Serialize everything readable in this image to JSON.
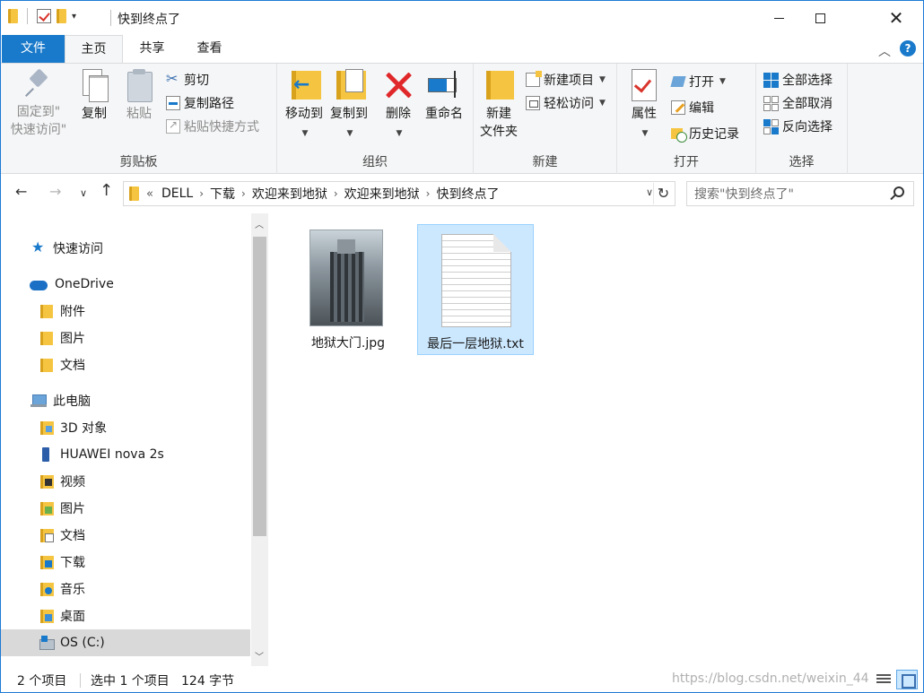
{
  "window": {
    "title": "快到终点了"
  },
  "ribbon_tabs": [
    "文件",
    "主页",
    "共享",
    "查看"
  ],
  "clipboard": {
    "pin_label_1": "固定到\"",
    "pin_label_2": "快速访问\"",
    "copy": "复制",
    "paste": "粘贴",
    "cut": "剪切",
    "copy_path": "复制路径",
    "paste_shortcut": "粘贴快捷方式",
    "group": "剪贴板"
  },
  "organize": {
    "move_to": "移动到",
    "copy_to": "复制到",
    "delete": "删除",
    "rename": "重命名",
    "group": "组织"
  },
  "new": {
    "new_folder_1": "新建",
    "new_folder_2": "文件夹",
    "new_item": "新建项目",
    "easy_access": "轻松访问",
    "group": "新建"
  },
  "open": {
    "properties": "属性",
    "open": "打开",
    "edit": "编辑",
    "history": "历史记录",
    "group": "打开"
  },
  "select": {
    "select_all": "全部选择",
    "select_none": "全部取消",
    "invert": "反向选择",
    "group": "选择"
  },
  "address": {
    "breadcrumbs": [
      "DELL",
      "下载",
      "欢迎来到地狱",
      "欢迎来到地狱",
      "快到终点了"
    ]
  },
  "search": {
    "placeholder": "搜索\"快到终点了\""
  },
  "nav_pane": {
    "items": [
      {
        "label": "快速访问",
        "icon": "star-icon"
      },
      {
        "label": "OneDrive",
        "icon": "cloud-icon"
      },
      {
        "label": "附件",
        "icon": "folder-icon"
      },
      {
        "label": "图片",
        "icon": "folder-icon"
      },
      {
        "label": "文档",
        "icon": "folder-icon"
      },
      {
        "label": "此电脑",
        "icon": "computer-icon"
      },
      {
        "label": "3D 对象",
        "icon": "3d-objects-icon"
      },
      {
        "label": "HUAWEI nova 2s",
        "icon": "phone-icon"
      },
      {
        "label": "视频",
        "icon": "videos-icon"
      },
      {
        "label": "图片",
        "icon": "pictures-icon"
      },
      {
        "label": "文档",
        "icon": "documents-icon"
      },
      {
        "label": "下载",
        "icon": "downloads-icon"
      },
      {
        "label": "音乐",
        "icon": "music-icon"
      },
      {
        "label": "桌面",
        "icon": "desktop-icon"
      },
      {
        "label": "OS (C:)",
        "icon": "drive-icon"
      }
    ]
  },
  "files": [
    {
      "name": "地狱大门.jpg",
      "selected": false
    },
    {
      "name": "最后一层地狱.txt",
      "selected": true
    }
  ],
  "status": {
    "item_count": "2 个项目",
    "selected": "选中 1 个项目",
    "size": "124 字节",
    "watermark": "https://blog.csdn.net/weixin_44"
  },
  "colors": {
    "accent": "#1979ca",
    "selection": "#cce8ff",
    "selection_border": "#99d1ff"
  }
}
